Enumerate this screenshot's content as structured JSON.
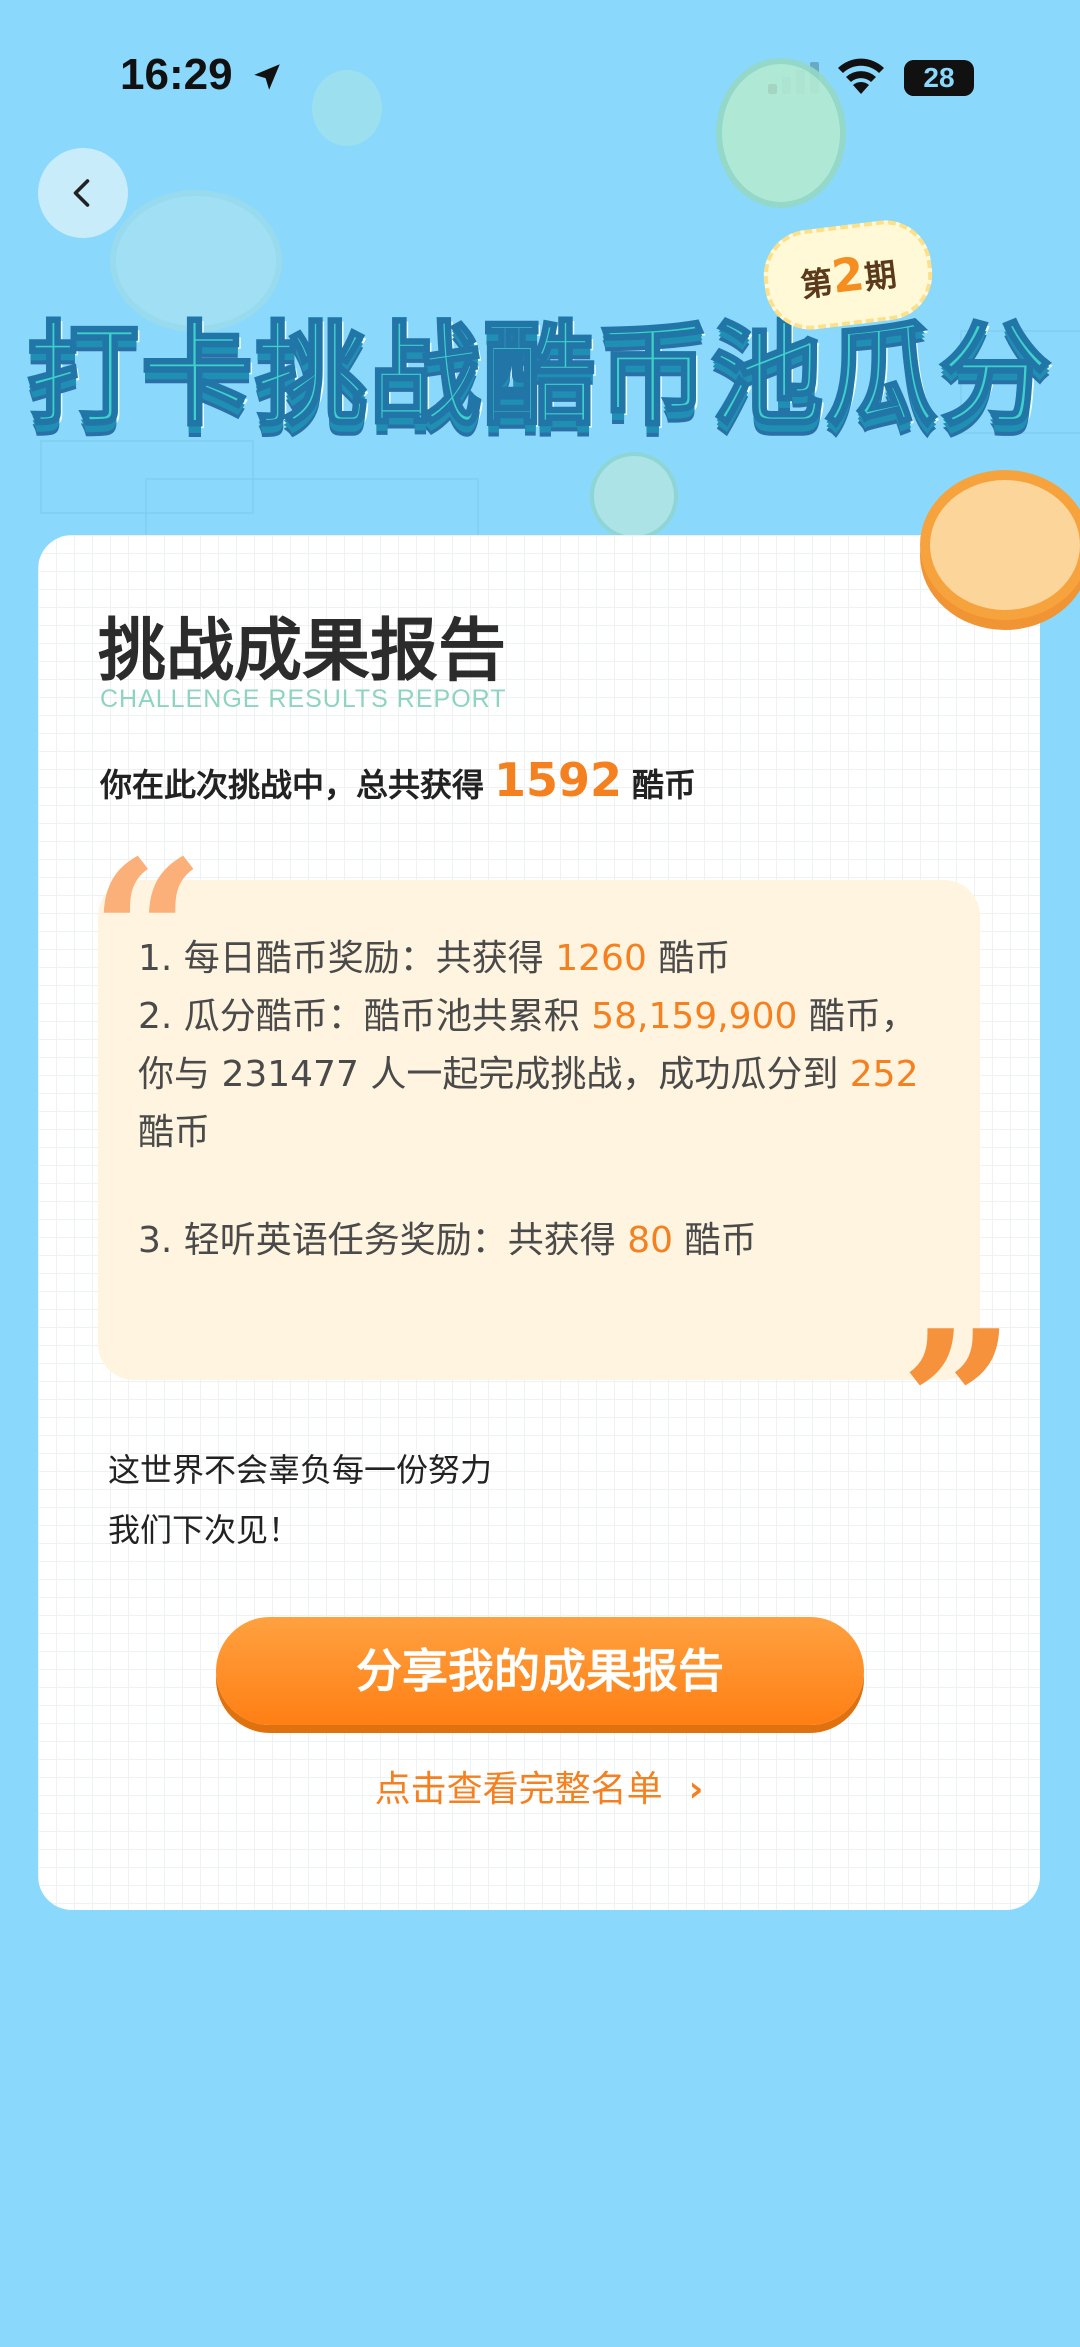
{
  "status_bar": {
    "time": "16:29",
    "battery": "28"
  },
  "header": {
    "title": "打卡挑战酷币池瓜分",
    "issue_prefix": "第",
    "issue_number": "2",
    "issue_suffix": "期"
  },
  "card": {
    "title": "挑战成果报告",
    "subtitle": "CHALLENGE RESULTS REPORT",
    "summary_prefix": "你在此次挑战中，总共获得",
    "summary_total": "1592",
    "summary_unit": "酷币",
    "items": [
      {
        "t1": "1. 每日酷币奖励：共获得",
        "v1": "1260",
        "t2": "酷币"
      },
      {
        "t1": "2. 瓜分酷币：酷币池共累积",
        "v1": "58,159,900",
        "t2": "酷币，你与 231477 人一起完成挑战，成功瓜分到",
        "v2": "252",
        "t3": "酷币"
      },
      {
        "t1": "3. 轻听英语任务奖励：共获得",
        "v1": "80",
        "t2": "酷币"
      }
    ],
    "closing_line1": "这世界不会辜负每一份努力",
    "closing_line2": "我们下次见！",
    "share_button": "分享我的成果报告",
    "full_list_link": "点击查看完整名单"
  },
  "colors": {
    "background": "#8ad8fb",
    "accent_orange": "#f5801f",
    "quote_bg": "#fff4e0",
    "title_teal": "#3ed1cc"
  },
  "icons": [
    "location-arrow-icon",
    "signal-icon",
    "wifi-icon",
    "battery-icon",
    "back-arrow-icon",
    "chevron-right-icon",
    "coin-icon"
  ]
}
